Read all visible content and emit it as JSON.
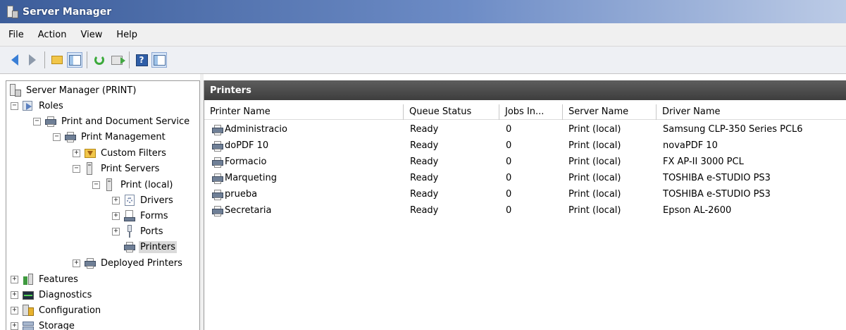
{
  "window": {
    "title": "Server Manager"
  },
  "menu": {
    "items": [
      "File",
      "Action",
      "View",
      "Help"
    ]
  },
  "toolbar": {
    "icons": [
      "back-arrow-icon",
      "forward-arrow-icon",
      "up-folder-icon",
      "show-hide-tree-icon",
      "refresh-icon",
      "export-list-icon",
      "help-icon",
      "action-pane-icon"
    ]
  },
  "tree": {
    "root": "Server Manager (PRINT)",
    "roles": "Roles",
    "print_doc_services": "Print and Document Service",
    "print_management": "Print Management",
    "custom_filters": "Custom Filters",
    "print_servers": "Print Servers",
    "print_local": "Print (local)",
    "drivers": "Drivers",
    "forms": "Forms",
    "ports": "Ports",
    "printers": "Printers",
    "deployed_printers": "Deployed Printers",
    "features": "Features",
    "diagnostics": "Diagnostics",
    "configuration": "Configuration",
    "storage": "Storage",
    "expand_symbol": "+",
    "collapse_symbol": "−"
  },
  "main": {
    "header": "Printers",
    "columns": [
      "Printer Name",
      "Queue Status",
      "Jobs In...",
      "Server Name",
      "Driver Name"
    ],
    "rows": [
      {
        "name": "Administracio",
        "status": "Ready",
        "jobs": "0",
        "server": "Print (local)",
        "driver": "Samsung CLP-350 Series PCL6"
      },
      {
        "name": "doPDF 10",
        "status": "Ready",
        "jobs": "0",
        "server": "Print (local)",
        "driver": "novaPDF 10"
      },
      {
        "name": "Formacio",
        "status": "Ready",
        "jobs": "0",
        "server": "Print (local)",
        "driver": "FX AP-II 3000 PCL"
      },
      {
        "name": "Marqueting",
        "status": "Ready",
        "jobs": "0",
        "server": "Print (local)",
        "driver": "TOSHIBA e-STUDIO PS3"
      },
      {
        "name": "prueba",
        "status": "Ready",
        "jobs": "0",
        "server": "Print (local)",
        "driver": "TOSHIBA e-STUDIO PS3"
      },
      {
        "name": "Secretaria",
        "status": "Ready",
        "jobs": "0",
        "server": "Print (local)",
        "driver": "Epson AL-2600"
      }
    ]
  },
  "colors": {
    "title_gradient_start": "#3c5d9a",
    "header_bg": "#4a4a4a",
    "selected_bg": "#dadada"
  }
}
